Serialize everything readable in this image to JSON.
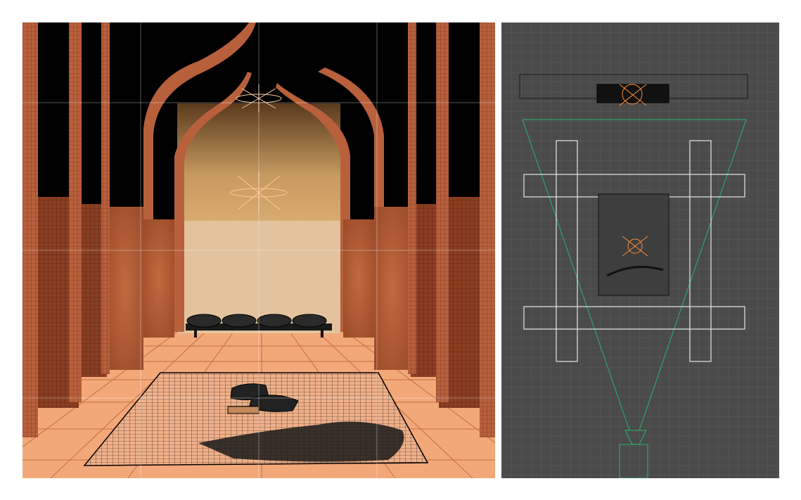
{
  "viewports": [
    {
      "id": "perspective",
      "icon": "perspective-viewport-icon"
    },
    {
      "id": "top",
      "icon": "top-view-viewport-icon"
    }
  ],
  "colors": {
    "wall_brick": "#b8603c",
    "wall_dark": "#7a3520",
    "floor_tile": "#f3a87a",
    "back_wall_upper": "#c7975e",
    "back_wall_lower": "#e2c39e",
    "wireframe": "#000000",
    "grid_bg": "#4a4a4a",
    "camera_frustum": "#2fa36a",
    "light_gizmo": "#ff8c3a"
  }
}
